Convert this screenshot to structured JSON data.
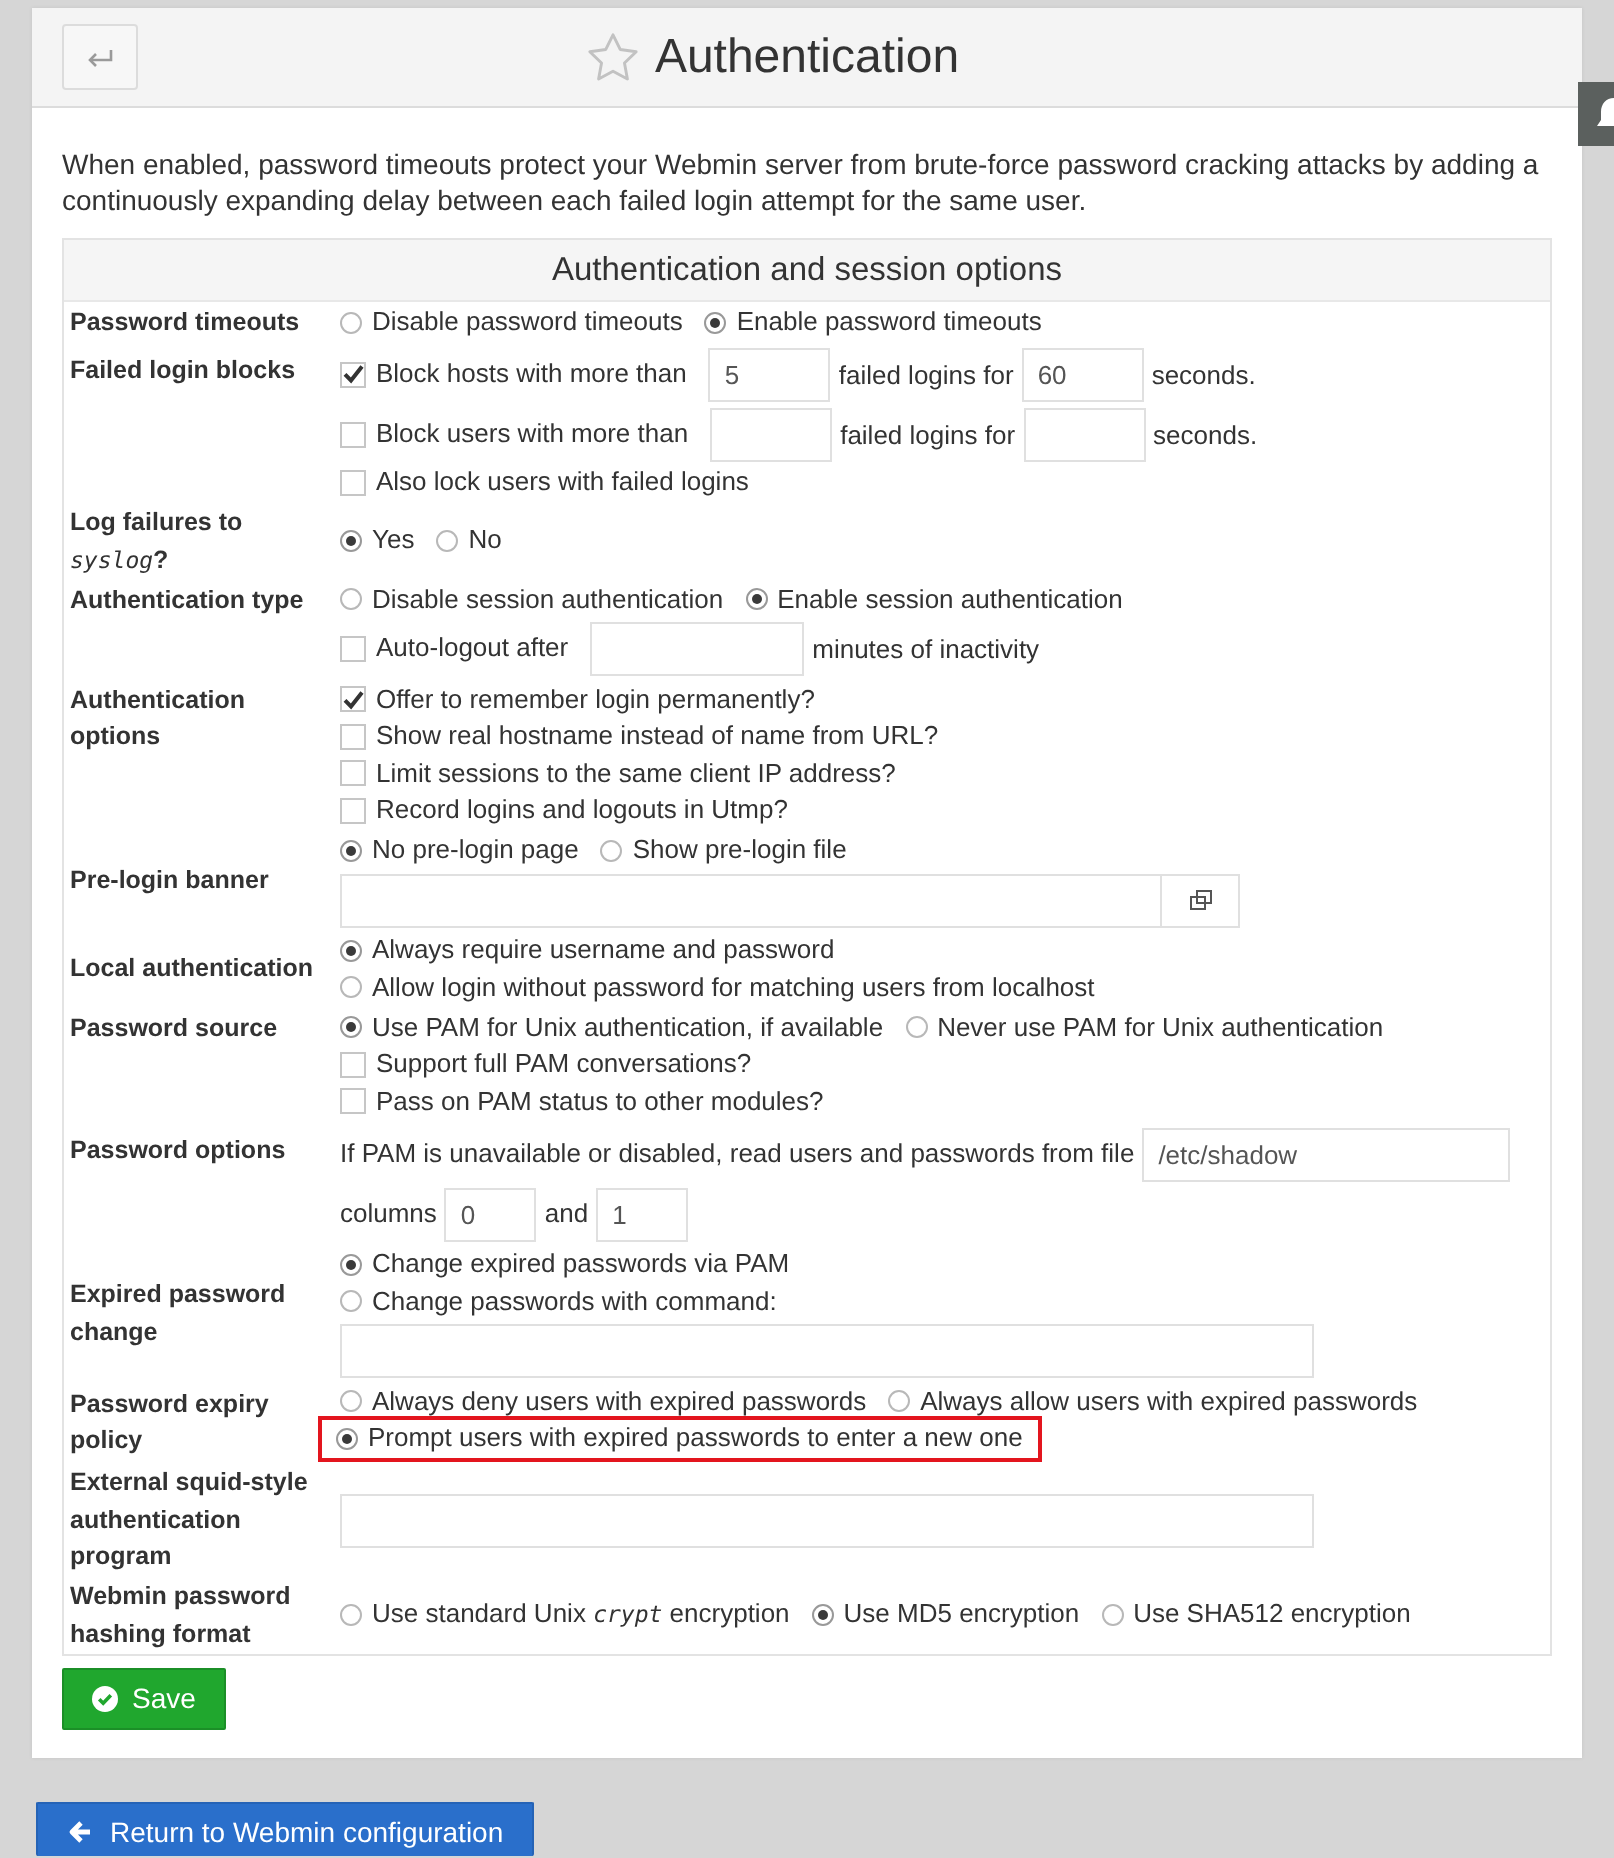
{
  "header": {
    "title": "Authentication",
    "favorite": false
  },
  "description": "When enabled, password timeouts protect your Webmin server from brute-force password cracking attacks by adding a continuously expanding delay between each failed login attempt for the same user.",
  "options_table": {
    "title": "Authentication and session options",
    "rows": [
      {
        "label": "Password timeouts",
        "lines": [
          [
            {
              "kind": "radio",
              "label": "Disable password timeouts",
              "selected": false
            },
            {
              "kind": "radio",
              "label": "Enable password timeouts",
              "selected": true
            }
          ]
        ]
      },
      {
        "label": "Failed login blocks",
        "lines": [
          [
            {
              "kind": "checkbox",
              "label": "Block hosts with more than",
              "checked": true
            },
            {
              "kind": "short-field",
              "value": "5"
            },
            {
              "kind": "text",
              "text": "failed logins for"
            },
            {
              "kind": "short-field",
              "value": "60"
            },
            {
              "kind": "text",
              "text": "seconds."
            }
          ],
          [
            {
              "kind": "checkbox",
              "label": "Block users with more than",
              "checked": false
            },
            {
              "kind": "short-field"
            },
            {
              "kind": "text",
              "text": "failed logins for"
            },
            {
              "kind": "short-field"
            },
            {
              "kind": "text",
              "text": "seconds."
            }
          ],
          [
            {
              "kind": "checkbox",
              "label": "Also lock users with failed logins",
              "checked": false
            }
          ]
        ]
      },
      {
        "label": "Log failures to *syslog*?",
        "lines": [
          [
            {
              "kind": "radio",
              "label": "Yes",
              "selected": true
            },
            {
              "kind": "radio",
              "label": "No",
              "selected": false
            }
          ]
        ]
      },
      {
        "label": "Authentication type",
        "lines": [
          [
            {
              "kind": "radio",
              "label": "Disable session authentication",
              "selected": false
            },
            {
              "kind": "radio",
              "label": "Enable session authentication",
              "selected": true
            }
          ],
          [
            {
              "kind": "checkbox",
              "label": "Auto-logout after",
              "checked": false
            },
            {
              "kind": "medium-field"
            },
            {
              "kind": "text",
              "text": "minutes of inactivity"
            }
          ]
        ]
      },
      {
        "label": "Authentication options",
        "lines": [
          [
            {
              "kind": "checkbox",
              "label": "Offer to remember login permanently?",
              "checked": true
            }
          ],
          [
            {
              "kind": "checkbox",
              "label": "Show real hostname instead of name from URL?",
              "checked": false
            }
          ],
          [
            {
              "kind": "checkbox",
              "label": "Limit sessions to the same client IP address?",
              "checked": false
            }
          ],
          [
            {
              "kind": "checkbox",
              "label": "Record logins and logouts in Utmp?",
              "checked": false
            }
          ]
        ]
      },
      {
        "label": "Pre-login banner",
        "lines": [
          [
            {
              "kind": "radio",
              "label": "No pre-login page",
              "selected": true
            },
            {
              "kind": "radio",
              "label": "Show pre-login file",
              "selected": false
            }
          ],
          [
            {
              "kind": "file-field"
            }
          ]
        ]
      },
      {
        "label": "Local authentication",
        "lines": [
          [
            {
              "kind": "radio",
              "label": "Always require username and password",
              "selected": true
            }
          ],
          [
            {
              "kind": "radio",
              "label": "Allow login without password for matching users from localhost",
              "selected": false
            }
          ]
        ]
      },
      {
        "label": "Password source",
        "lines": [
          [
            {
              "kind": "radio",
              "label": "Use PAM for Unix authentication, if available",
              "selected": true
            },
            {
              "kind": "radio",
              "label": "Never use PAM for Unix authentication",
              "selected": false
            }
          ],
          [
            {
              "kind": "checkbox",
              "label": "Support full PAM conversations?",
              "checked": false
            }
          ],
          [
            {
              "kind": "checkbox",
              "label": "Pass on PAM status to other modules?",
              "checked": false
            }
          ]
        ]
      },
      {
        "label": "Password options",
        "lines": [
          [
            {
              "kind": "text",
              "text": "If PAM is unavailable or disabled, read users and passwords from file"
            },
            {
              "kind": "path-field",
              "value": "/etc/shadow"
            }
          ],
          [
            {
              "kind": "text",
              "text": "columns"
            },
            {
              "kind": "tiny-field",
              "value": "0"
            },
            {
              "kind": "text",
              "text": "and"
            },
            {
              "kind": "tiny-field",
              "value": "1"
            }
          ]
        ]
      },
      {
        "label": "Expired password change",
        "lines": [
          [
            {
              "kind": "radio",
              "label": "Change expired passwords via PAM",
              "selected": true
            }
          ],
          [
            {
              "kind": "radio",
              "label": "Change passwords with command:",
              "selected": false
            }
          ],
          [
            {
              "kind": "long-field"
            }
          ]
        ]
      },
      {
        "label": "Password expiry policy",
        "lines": [
          [
            {
              "kind": "radio",
              "label": "Always deny users with expired passwords",
              "selected": false,
              "highlighted": false
            },
            {
              "kind": "radio",
              "label": "Always allow users with expired passwords",
              "selected": false,
              "highlighted": false
            }
          ],
          [
            {
              "kind": "radio",
              "label": "Prompt users with expired passwords to enter a new one",
              "selected": true,
              "highlighted": true
            }
          ]
        ]
      },
      {
        "label": "External squid-style authentication program",
        "lines": [
          [
            {
              "kind": "long-field"
            }
          ]
        ]
      },
      {
        "label": "Webmin password hashing format",
        "lines": [
          [
            {
              "kind": "radio",
              "label": "Use standard Unix *crypt* encryption",
              "selected": false
            },
            {
              "kind": "radio",
              "label": "Use MD5 encryption",
              "selected": true
            },
            {
              "kind": "radio",
              "label": "Use SHA512 encryption",
              "selected": false
            }
          ]
        ]
      }
    ]
  },
  "save_button": {
    "label": "Save"
  },
  "return_button": {
    "label": "Return to Webmin configuration"
  }
}
